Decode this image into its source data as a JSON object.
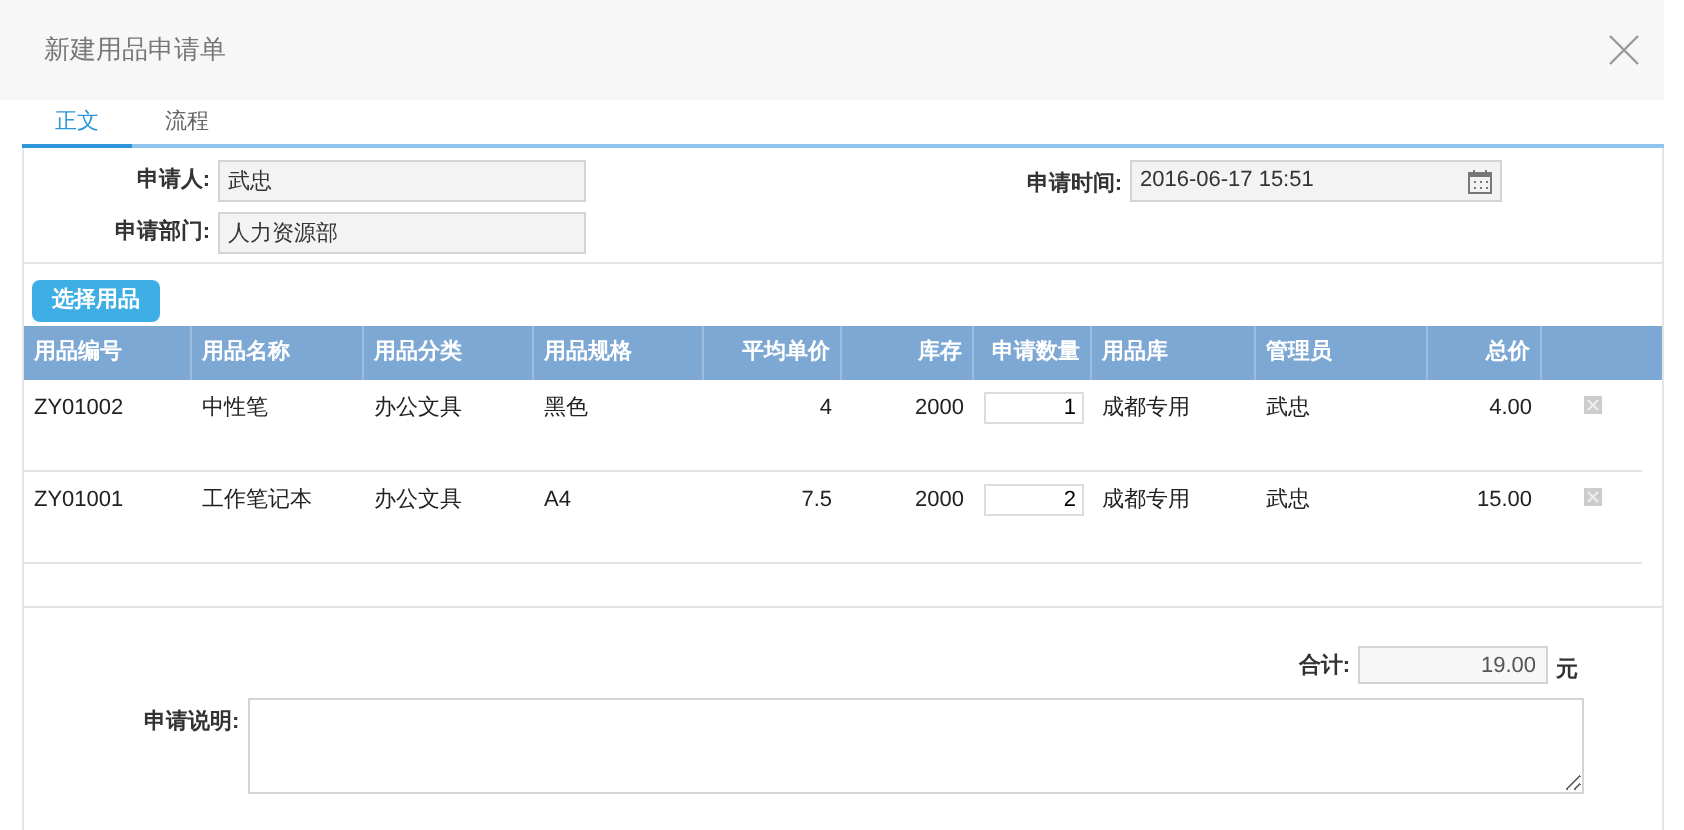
{
  "window": {
    "title": "新建用品申请单"
  },
  "tabs": [
    {
      "label": "正文",
      "selected": true
    },
    {
      "label": "流程",
      "selected": false
    }
  ],
  "form": {
    "applicant": {
      "label": "申请人:",
      "value": "武忠"
    },
    "department": {
      "label": "申请部门:",
      "value": "人力资源部"
    },
    "time": {
      "label": "申请时间:",
      "value": "2016-06-17 15:51"
    }
  },
  "select_button": "选择用品",
  "table": {
    "columns": [
      "用品编号",
      "用品名称",
      "用品分类",
      "用品规格",
      "平均单价",
      "库存",
      "申请数量",
      "用品库",
      "管理员",
      "总价"
    ],
    "rows": [
      {
        "code": "ZY01002",
        "name": "中性笔",
        "category": "办公文具",
        "spec": "黑色",
        "price": "4",
        "stock": "2000",
        "quantity": "1",
        "warehouse": "成都专用",
        "manager": "武忠",
        "total": "4.00"
      },
      {
        "code": "ZY01001",
        "name": "工作笔记本",
        "category": "办公文具",
        "spec": "A4",
        "price": "7.5",
        "stock": "2000",
        "quantity": "2",
        "warehouse": "成都专用",
        "manager": "武忠",
        "total": "15.00"
      }
    ]
  },
  "sum": {
    "label": "合计:",
    "value": "19.00",
    "unit": "元"
  },
  "remark": {
    "label": "申请说明:"
  }
}
